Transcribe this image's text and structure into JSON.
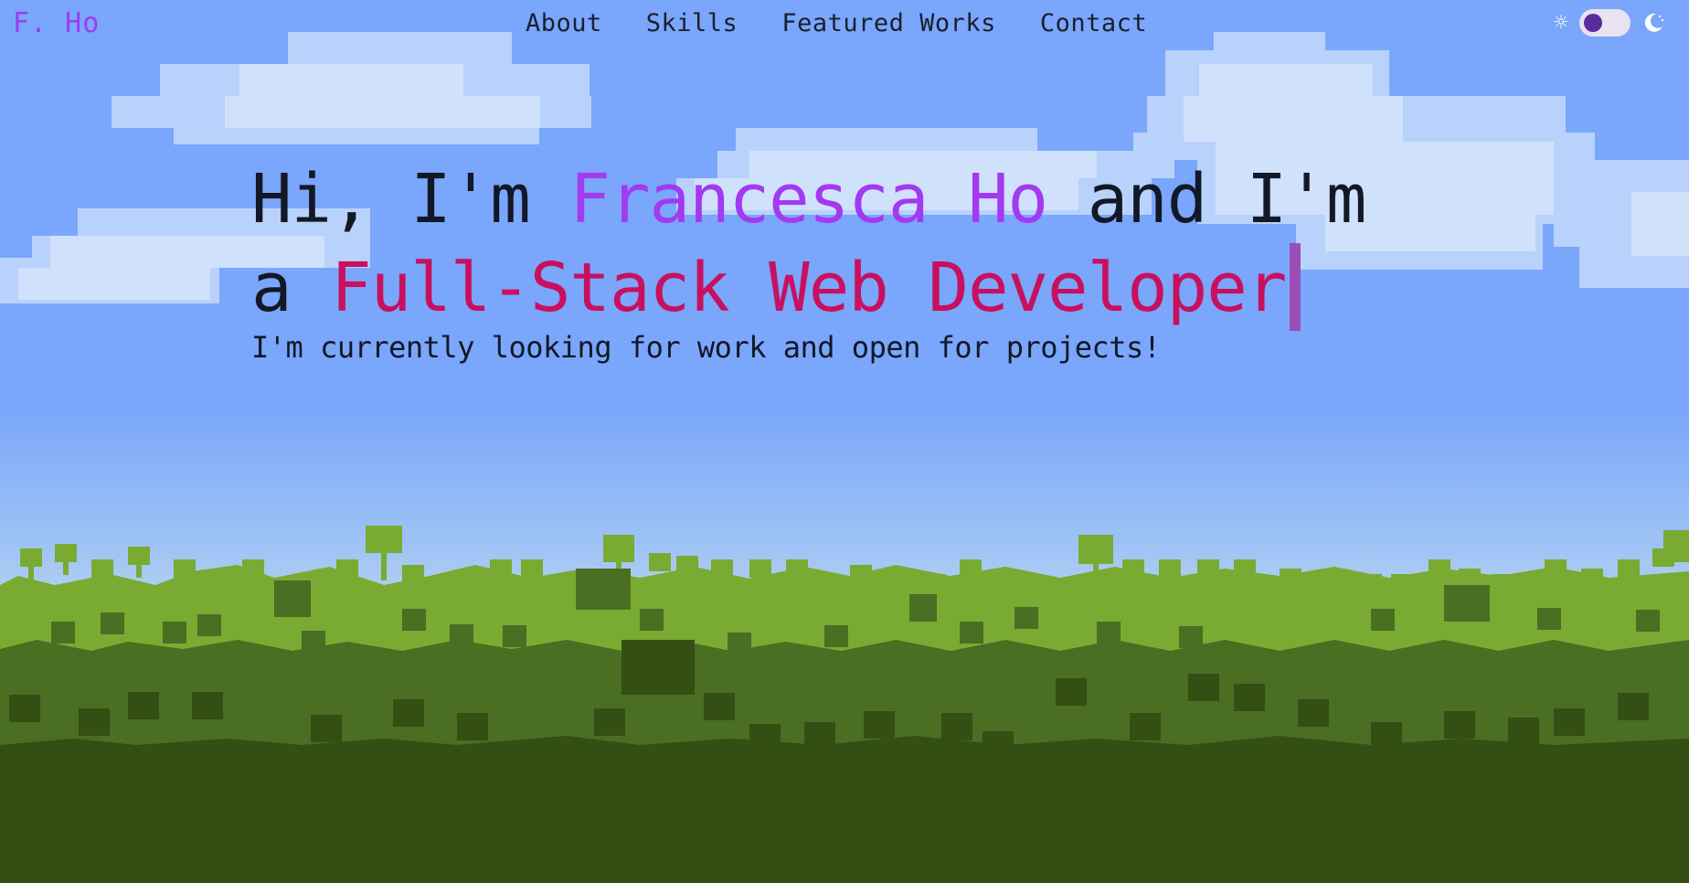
{
  "header": {
    "logo": "F. Ho",
    "nav": [
      {
        "label": "About"
      },
      {
        "label": "Skills"
      },
      {
        "label": "Featured Works"
      },
      {
        "label": "Contact"
      }
    ],
    "theme_toggle": {
      "sun_icon": "sun-icon",
      "moon_icon": "moon-icon",
      "state": "light"
    }
  },
  "hero": {
    "greeting_pre": "Hi, I'm ",
    "name": "Francesca Ho",
    "greeting_mid": " and I'm a ",
    "role": "Full-Stack Web Developer",
    "tagline": "I'm currently looking for work and open for projects!"
  },
  "colors": {
    "sky": "#7aa6fb",
    "accent_name": "#a23af0",
    "accent_role": "#c8105e",
    "text": "#121826",
    "forest_dark": "#334f14",
    "forest_mid": "#4a6e22",
    "forest_light": "#79ab32"
  }
}
